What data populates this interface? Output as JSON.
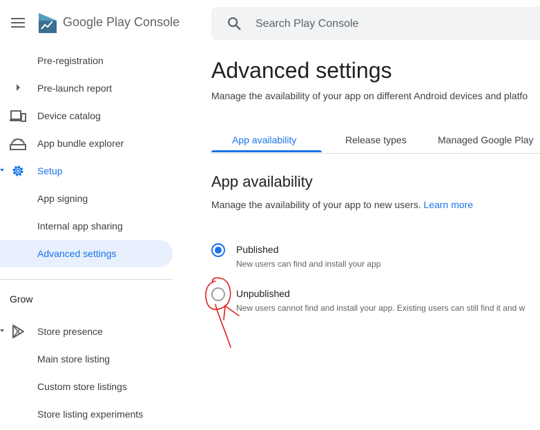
{
  "header": {
    "app_name": "Google Play Console",
    "search_placeholder": "Search Play Console"
  },
  "sidebar": {
    "items": [
      {
        "label": "Pre-registration"
      },
      {
        "label": "Pre-launch report"
      },
      {
        "label": "Device catalog"
      },
      {
        "label": "App bundle explorer"
      },
      {
        "label": "Setup"
      },
      {
        "label": "App signing"
      },
      {
        "label": "Internal app sharing"
      },
      {
        "label": "Advanced settings"
      },
      {
        "label": "Store presence"
      },
      {
        "label": "Main store listing"
      },
      {
        "label": "Custom store listings"
      },
      {
        "label": "Store listing experiments"
      }
    ],
    "section_grow": "Grow"
  },
  "main": {
    "title": "Advanced settings",
    "description": "Manage the availability of your app on different Android devices and platfo",
    "tabs": [
      {
        "label": "App availability"
      },
      {
        "label": "Release types"
      },
      {
        "label": "Managed Google Play"
      }
    ],
    "section_title": "App availability",
    "section_desc": "Manage the availability of your app to new users.",
    "learn_more": "Learn more",
    "options": [
      {
        "label": "Published",
        "description": "New users can find and install your app",
        "selected": true
      },
      {
        "label": "Unpublished",
        "description": "New users cannot find and install your app. Existing users can still find it and w",
        "selected": false
      }
    ]
  },
  "colors": {
    "accent": "#1a73e8",
    "annotation": "#e0201c",
    "active_bg": "#e8f0fe"
  }
}
